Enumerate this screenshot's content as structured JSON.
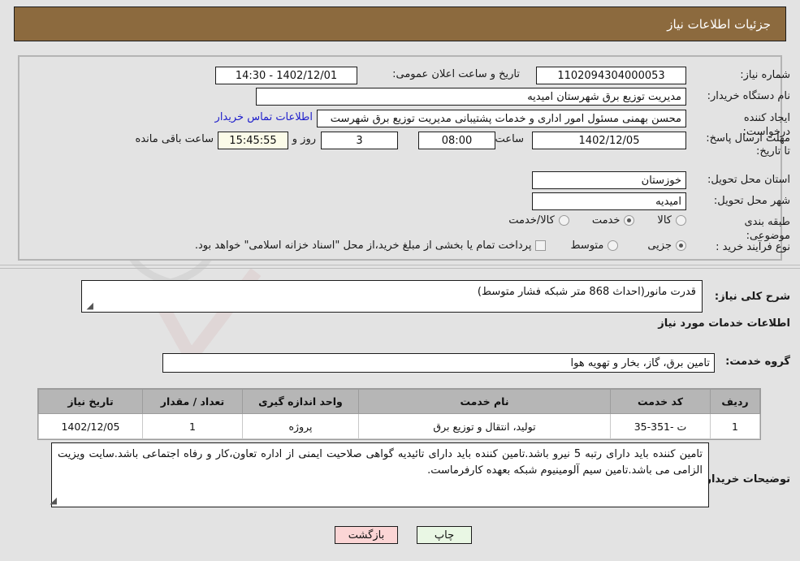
{
  "header": {
    "title": "جزئیات اطلاعات نیاز"
  },
  "form": {
    "need_number_label": "شماره نیاز:",
    "need_number_value": "1102094304000053",
    "announce_datetime_label": "تاریخ و ساعت اعلان عمومی:",
    "announce_datetime_value": "14:30 - 1402/12/01",
    "buyer_org_label": "نام دستگاه خریدار:",
    "buyer_org_value": "مدیریت توزیع برق شهرستان امیدیه",
    "creator_label": "ایجاد کننده درخواست:",
    "creator_value": "محسن بهمنی مسئول امور اداری و خدمات پشتیبانی مدیریت توزیع برق شهرست",
    "buyer_contact_link": "اطلاعات تماس خریدار",
    "deadline_label": "مهلت ارسال پاسخ: تا تاریخ:",
    "deadline_date": "1402/12/05",
    "deadline_time_label": "ساعت",
    "deadline_time": "08:00",
    "remaining_days": "3",
    "remaining_days_label": "روز و",
    "remaining_clock": "15:45:55",
    "remaining_suffix_label": "ساعت باقی مانده",
    "province_label": "استان محل تحویل:",
    "province_value": "خوزستان",
    "city_label": "شهر محل تحویل:",
    "city_value": "امیدیه",
    "category_label": "طبقه بندی موضوعی:",
    "category_options": [
      {
        "label": "کالا",
        "selected": false
      },
      {
        "label": "خدمت",
        "selected": true
      },
      {
        "label": "کالا/خدمت",
        "selected": false
      }
    ],
    "process_type_label": "نوع فرآیند خرید :",
    "process_type_options": [
      {
        "label": "جزیی",
        "selected": true
      },
      {
        "label": "متوسط",
        "selected": false
      }
    ],
    "treasury_checkbox_label": "پرداخت تمام یا بخشی از مبلغ خرید،از محل \"اسناد خزانه اسلامی\" خواهد بود.",
    "treasury_checked": false
  },
  "description": {
    "label": "شرح کلی نیاز:",
    "value": "قدرت مانور(احداث 868 متر شبکه فشار متوسط)"
  },
  "services_section": {
    "heading": "اطلاعات خدمات مورد نیاز",
    "group_label": "گروه خدمت:",
    "group_value": "تامین برق، گاز، بخار و تهویه هوا"
  },
  "table": {
    "columns": [
      "ردیف",
      "کد خدمت",
      "نام خدمت",
      "واحد اندازه گیری",
      "تعداد / مقدار",
      "تاریخ نیاز"
    ],
    "rows": [
      {
        "row_no": "1",
        "service_code": "ت -351-35",
        "service_name": "تولید، انتقال و توزیع برق",
        "unit": "پروژه",
        "quantity": "1",
        "need_date": "1402/12/05"
      }
    ]
  },
  "buyer_notes": {
    "label": "توضیحات خریدار:",
    "value": "تامین کننده باید دارای رتبه 5 نیرو باشد.تامین کننده باید دارای تائیدیه گواهی صلاحیت ایمنی از اداره تعاون،کار و رفاه اجتماعی باشد.سایت ویزیت الزامی می باشد.تامین سیم آلومینیوم شبکه بعهده کارفرماست."
  },
  "buttons": {
    "print": "چاپ",
    "back": "بازگشت"
  },
  "watermark": {
    "text": "AriaTender.net"
  },
  "colors": {
    "header_bg": "#8c6a3e",
    "page_bg": "#e3e3e3",
    "link": "#2020cc",
    "table_header_bg": "#b6b6b6",
    "print_btn_bg": "#e9f7e4",
    "back_btn_bg": "#fbd5d5",
    "highlight_field_bg": "#fbfbe8"
  }
}
